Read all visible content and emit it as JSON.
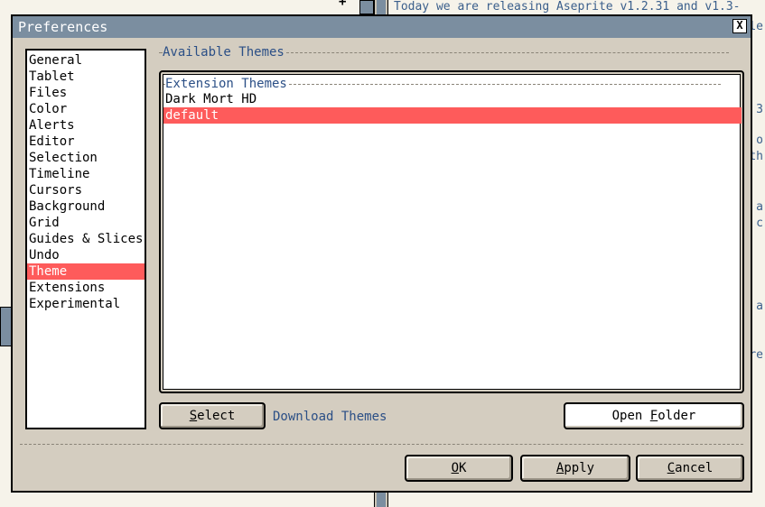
{
  "background": {
    "text": "Today we are releasing Aseprite v1.2.31 and v1.3-",
    "fragments": [
      "le",
      "3",
      "o",
      "th",
      "a",
      "c",
      "a",
      "re"
    ]
  },
  "dialog": {
    "title": "Preferences",
    "close_label": "X"
  },
  "sidebar": {
    "items": [
      {
        "label": "General"
      },
      {
        "label": "Tablet"
      },
      {
        "label": "Files"
      },
      {
        "label": "Color"
      },
      {
        "label": "Alerts"
      },
      {
        "label": "Editor"
      },
      {
        "label": "Selection"
      },
      {
        "label": "Timeline"
      },
      {
        "label": "Cursors"
      },
      {
        "label": "Background"
      },
      {
        "label": "Grid"
      },
      {
        "label": "Guides & Slices"
      },
      {
        "label": "Undo"
      },
      {
        "label": "Theme",
        "selected": true
      },
      {
        "label": "Extensions"
      },
      {
        "label": "Experimental"
      }
    ]
  },
  "theme_panel": {
    "section_title": "Available Themes",
    "group_title": "Extension Themes",
    "themes": [
      {
        "label": "Dark Mort HD"
      },
      {
        "label": "default",
        "selected": true
      }
    ],
    "select_button": {
      "prefix": "",
      "mnemonic": "S",
      "rest": "elect"
    },
    "download_link": "Download Themes",
    "open_folder_button": {
      "prefix": "Open ",
      "mnemonic": "F",
      "rest": "older"
    }
  },
  "footer": {
    "ok_button": {
      "prefix": "",
      "mnemonic": "O",
      "rest": "K"
    },
    "apply_button": {
      "prefix": "",
      "mnemonic": "A",
      "rest": "pply"
    },
    "cancel_button": {
      "prefix": "",
      "mnemonic": "C",
      "rest": "ancel"
    }
  },
  "colors": {
    "selection": "#fe5b5b",
    "titlebar": "#7b8ea0",
    "dialog_bg": "#d4cdc0",
    "link": "#2b4f86"
  }
}
